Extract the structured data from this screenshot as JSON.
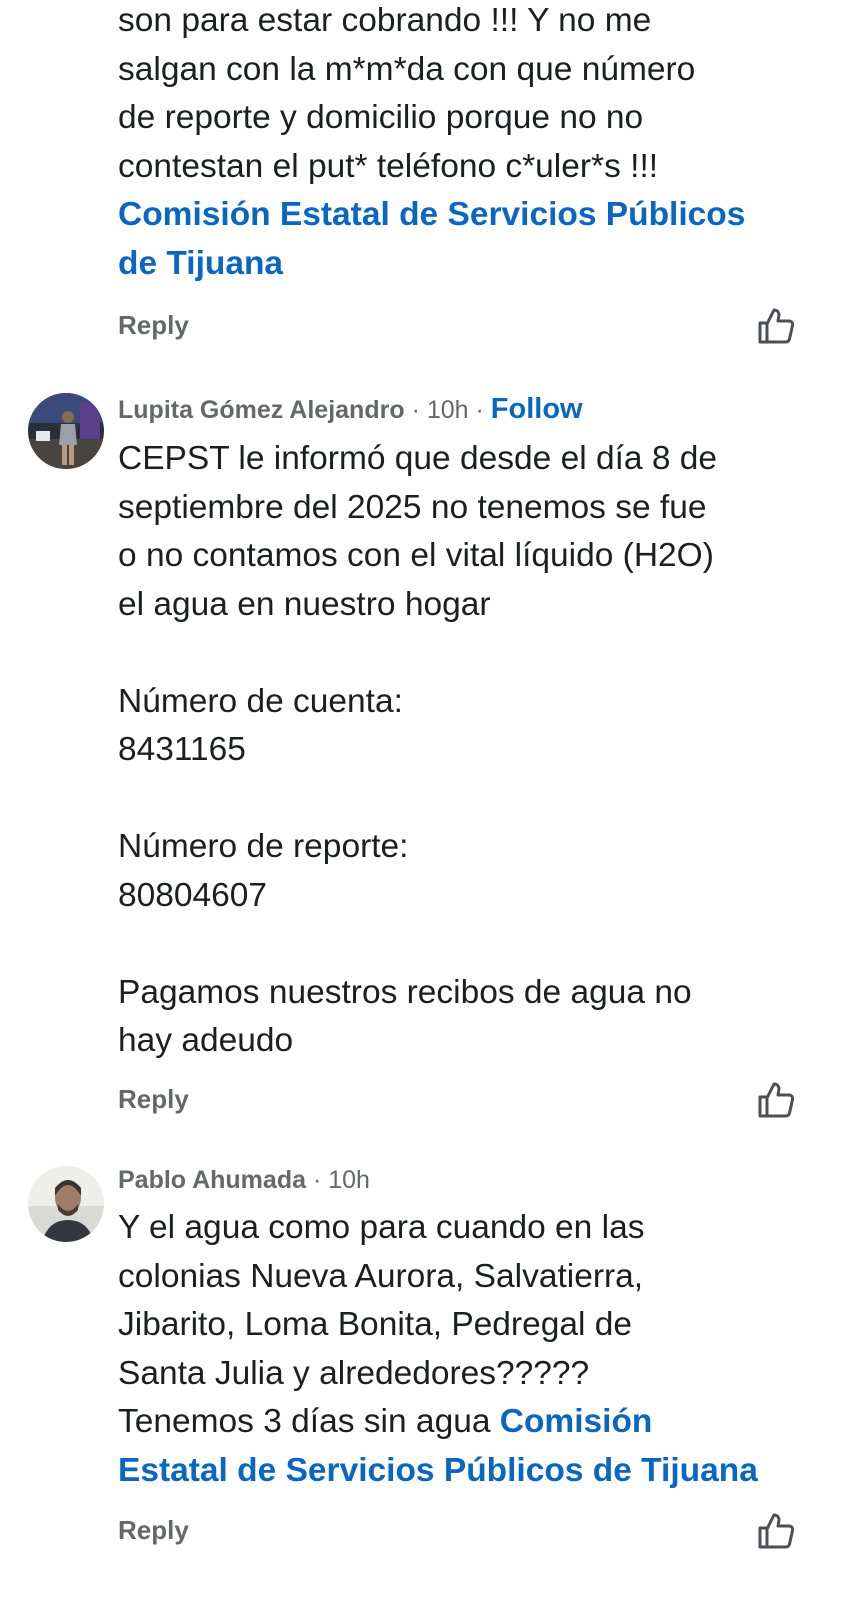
{
  "comments": [
    {
      "text_lines": [
        "son para estar cobrando !!! Y no me",
        "salgan con la m*m*da con que número",
        "de reporte y domicilio porque no no",
        "contestan el put* teléfono c*uler*s !!!"
      ],
      "mention_lines": [
        "Comisión Estatal de Servicios Públicos",
        "de Tijuana"
      ],
      "reply_label": "Reply"
    },
    {
      "author": "Lupita Gómez Alejandro",
      "time": "· 10h ·",
      "follow_label": "Follow",
      "text": "CEPST le informó que desde el día 8 de\nseptiembre del 2025 no tenemos se fue\no no contamos con el vital líquido (H2O)\nel agua en nuestro hogar\n\nNúmero de cuenta:\n8431165\n\nNúmero de reporte:\n80804607\n\nPagamos nuestros recibos de agua no\nhay adeudo",
      "reply_label": "Reply"
    },
    {
      "author": "Pablo Ahumada",
      "time": "· 10h",
      "text": "Y el agua como para cuando en las\ncolonias Nueva Aurora, Salvatierra,\nJibarito, Loma Bonita, Pedregal de\nSanta Julia y alrededores?????\nTenemos 3 días sin agua ",
      "mention_inline": "Comisión",
      "mention_last_line": "Estatal de Servicios Públicos de Tijuana",
      "reply_label": "Reply"
    }
  ],
  "colors": {
    "link": "#0a66c2",
    "meta": "#65676b",
    "text": "#1c1e21"
  },
  "icons": {
    "like": "thumbs-up-outline-icon"
  }
}
